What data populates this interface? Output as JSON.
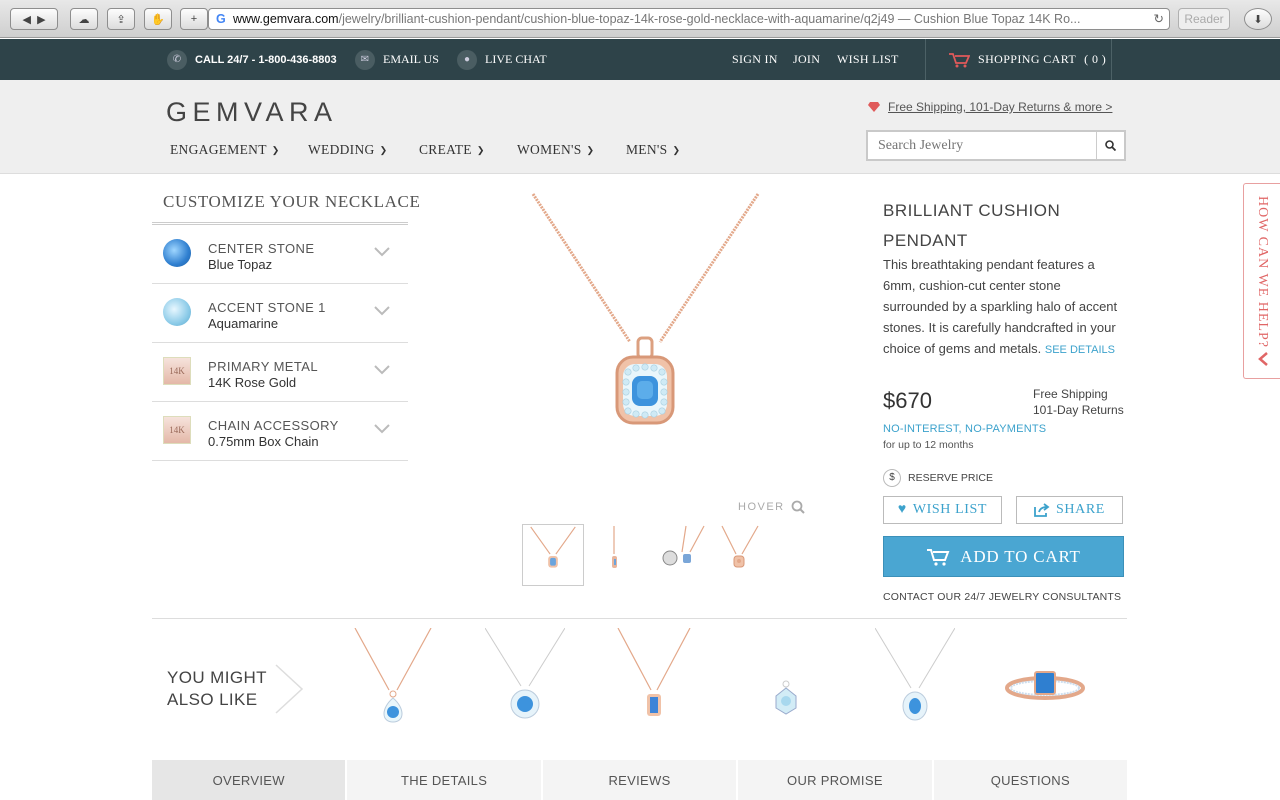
{
  "browser": {
    "url_domain": "www.gemvara.com",
    "url_path": "/jewelry/brilliant-cushion-pendant/cushion-blue-topaz-14k-rose-gold-necklace-with-aquamarine/q2j49",
    "url_title": " — Cushion Blue Topaz 14K Ro...",
    "reader": "Reader"
  },
  "topbar": {
    "call": "CALL 24/7 - 1-800-436-8803",
    "email": "EMAIL US",
    "chat": "LIVE CHAT",
    "sign_in": "SIGN IN",
    "join": "JOIN",
    "wish_list": "WISH LIST",
    "cart": "SHOPPING CART",
    "cart_count": "( 0 )"
  },
  "header": {
    "logo": "GEMVARA",
    "promo": "Free Shipping, 101-Day Returns & more >",
    "search_placeholder": "Search Jewelry",
    "nav": [
      "ENGAGEMENT",
      "WEDDING",
      "CREATE",
      "WOMEN'S",
      "MEN'S"
    ]
  },
  "customize": {
    "title": "CUSTOMIZE YOUR NECKLACE",
    "options": [
      {
        "label": "CENTER STONE",
        "value": "Blue Topaz",
        "swatch": "#3f8fd8"
      },
      {
        "label": "ACCENT STONE 1",
        "value": "Aquamarine",
        "swatch": "#8ccbe8"
      },
      {
        "label": "PRIMARY METAL",
        "value": "14K Rose Gold",
        "badge": "14K"
      },
      {
        "label": "CHAIN ACCESSORY",
        "value": "0.75mm Box Chain",
        "badge": "14K"
      }
    ]
  },
  "gallery": {
    "hover": "HOVER"
  },
  "product": {
    "title": "BRILLIANT CUSHION PENDANT",
    "description": "This breathtaking pendant features a 6mm, cushion-cut center stone surrounded by a sparkling halo of accent stones. It is carefully handcrafted in your choice of gems and metals.",
    "see_details": "SEE DETAILS",
    "price": "$670",
    "shipping": "Free Shipping",
    "returns": "101-Day Returns",
    "financing": "NO-INTEREST, NO-PAYMENTS",
    "financing_term": "for up to 12 months",
    "reserve": "RESERVE PRICE",
    "wish_list": "WISH LIST",
    "share": "SHARE",
    "add_to_cart": "ADD TO CART",
    "consult": "CONTACT OUR 24/7 JEWELRY CONSULTANTS"
  },
  "help": {
    "label": "HOW CAN WE HELP?"
  },
  "recommendations": {
    "title_line1": "YOU MIGHT",
    "title_line2": "ALSO LIKE"
  },
  "tabs": [
    "OVERVIEW",
    "THE DETAILS",
    "REVIEWS",
    "OUR PROMISE",
    "QUESTIONS"
  ],
  "colors": {
    "topbar": "#2e4349",
    "accent": "#4aa6d2",
    "rose_gold": "#e8a98e",
    "blue_topaz": "#3f8fd8",
    "help": "#e06666"
  }
}
